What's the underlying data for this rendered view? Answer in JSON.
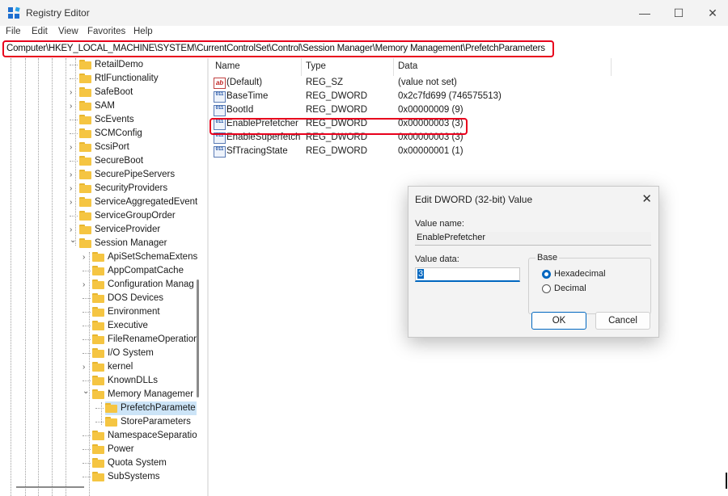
{
  "window": {
    "title": "Registry Editor",
    "controls": [
      "—",
      "☐",
      "✕"
    ]
  },
  "menu": [
    "File",
    "Edit",
    "View",
    "Favorites",
    "Help"
  ],
  "address": {
    "path": "Computer\\HKEY_LOCAL_MACHINE\\SYSTEM\\CurrentControlSet\\Control\\Session Manager\\Memory Management\\PrefetchParameters"
  },
  "tree": {
    "items": [
      {
        "label": "RetailDemo",
        "expandable": false
      },
      {
        "label": "RtlFunctionality",
        "expandable": false
      },
      {
        "label": "SafeBoot",
        "expandable": true
      },
      {
        "label": "SAM",
        "expandable": true
      },
      {
        "label": "ScEvents",
        "expandable": false
      },
      {
        "label": "SCMConfig",
        "expandable": false
      },
      {
        "label": "ScsiPort",
        "expandable": true
      },
      {
        "label": "SecureBoot",
        "expandable": false
      },
      {
        "label": "SecurePipeServers",
        "expandable": true
      },
      {
        "label": "SecurityProviders",
        "expandable": true
      },
      {
        "label": "ServiceAggregatedEvent",
        "expandable": true
      },
      {
        "label": "ServiceGroupOrder",
        "expandable": false
      },
      {
        "label": "ServiceProvider",
        "expandable": true
      },
      {
        "label": "Session Manager",
        "expandable": true,
        "expanded": true
      },
      {
        "label": "ApiSetSchemaExtens",
        "expandable": true
      },
      {
        "label": "AppCompatCache",
        "expandable": false
      },
      {
        "label": "Configuration Manag",
        "expandable": true
      },
      {
        "label": "DOS Devices",
        "expandable": false
      },
      {
        "label": "Environment",
        "expandable": false
      },
      {
        "label": "Executive",
        "expandable": false
      },
      {
        "label": "FileRenameOperatior",
        "expandable": false
      },
      {
        "label": "I/O System",
        "expandable": false
      },
      {
        "label": "kernel",
        "expandable": true
      },
      {
        "label": "KnownDLLs",
        "expandable": false
      },
      {
        "label": "Memory Managemer",
        "expandable": true,
        "expanded": true
      },
      {
        "label": "PrefetchParamete",
        "expandable": false,
        "selected": true
      },
      {
        "label": "StoreParameters",
        "expandable": false
      },
      {
        "label": "NamespaceSeparatio",
        "expandable": false
      },
      {
        "label": "Power",
        "expandable": false
      },
      {
        "label": "Quota System",
        "expandable": false
      },
      {
        "label": "SubSystems",
        "expandable": false
      }
    ]
  },
  "list": {
    "headers": [
      "Name",
      "Type",
      "Data"
    ],
    "rows": [
      {
        "name": "(Default)",
        "type": "REG_SZ",
        "data": "(value not set)",
        "icon": "string-value-icon"
      },
      {
        "name": "BaseTime",
        "type": "REG_DWORD",
        "data": "0x2c7fd699 (746575513)",
        "icon": "dword-value-icon"
      },
      {
        "name": "BootId",
        "type": "REG_DWORD",
        "data": "0x00000009 (9)",
        "icon": "dword-value-icon"
      },
      {
        "name": "EnablePrefetcher",
        "type": "REG_DWORD",
        "data": "0x00000003 (3)",
        "icon": "dword-value-icon"
      },
      {
        "name": "EnableSuperfetch",
        "type": "REG_DWORD",
        "data": "0x00000003 (3)",
        "icon": "dword-value-icon"
      },
      {
        "name": "SfTracingState",
        "type": "REG_DWORD",
        "data": "0x00000001 (1)",
        "icon": "dword-value-icon"
      }
    ]
  },
  "dialog": {
    "title": "Edit DWORD (32-bit) Value",
    "value_name_label": "Value name:",
    "value_name": "EnablePrefetcher",
    "value_data_label": "Value data:",
    "value_data": "3",
    "base_label": "Base",
    "hex_label": "Hexadecimal",
    "dec_label": "Decimal",
    "selected_base": "Hexadecimal",
    "ok": "OK",
    "cancel": "Cancel"
  },
  "colors": {
    "highlight_border": "#e8001c",
    "accent": "#0067c0",
    "selection": "#cce4f7",
    "folder": "#f5c542"
  }
}
